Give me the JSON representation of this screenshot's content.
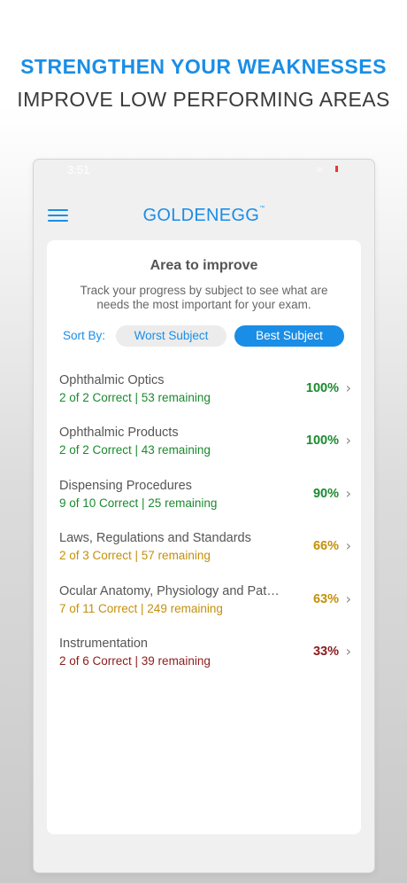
{
  "banner": {
    "headline": "STRENGTHEN YOUR WEAKNESSES",
    "subheadline": "IMPROVE LOW PERFORMING AREAS"
  },
  "status_bar": {
    "time": "3:51",
    "wifi_icon": "wifi-icon"
  },
  "header": {
    "logo_text": "GOLDENEGG",
    "logo_mark": "™",
    "menu_icon": "hamburger-icon"
  },
  "card": {
    "title": "Area to improve",
    "description": "Track your progress by subject to see what are needs the most important for your exam.",
    "sort_label": "Sort By:",
    "sort_options": [
      "Worst Subject",
      "Best Subject"
    ],
    "selected_sort": "Best Subject"
  },
  "colors": {
    "accent": "#1a8ee6",
    "high": "#1a8a2e",
    "mid": "#c4900a",
    "low": "#8b1c1c"
  },
  "subjects": [
    {
      "name": "Ophthalmic Optics",
      "stats": "2 of 2 Correct | 53 remaining",
      "percent": "100%",
      "color": "#1a8a2e"
    },
    {
      "name": "Ophthalmic Products",
      "stats": "2 of 2 Correct | 43 remaining",
      "percent": "100%",
      "color": "#1a8a2e"
    },
    {
      "name": "Dispensing Procedures",
      "stats": "9 of 10 Correct | 25 remaining",
      "percent": "90%",
      "color": "#1a8a2e"
    },
    {
      "name": "Laws, Regulations and Standards",
      "stats": "2 of 3 Correct | 57 remaining",
      "percent": "66%",
      "color": "#c4900a"
    },
    {
      "name": "Ocular Anatomy, Physiology and Pat…",
      "stats": "7 of 11 Correct | 249 remaining",
      "percent": "63%",
      "color": "#c4900a"
    },
    {
      "name": "Instrumentation",
      "stats": "2 of 6 Correct | 39 remaining",
      "percent": "33%",
      "color": "#8b1c1c"
    }
  ]
}
